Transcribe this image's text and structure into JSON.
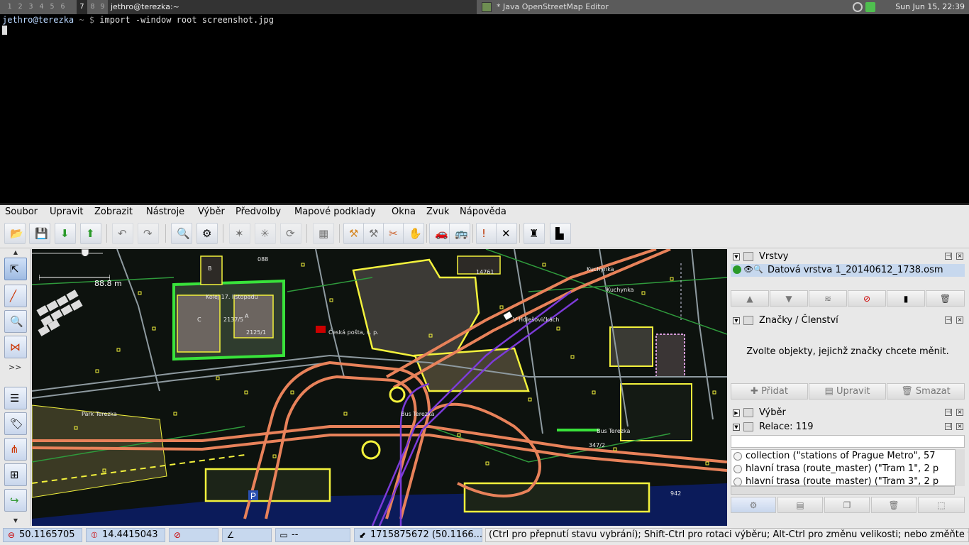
{
  "taskbar": {
    "workspaces": [
      "1",
      "2",
      "3",
      "4",
      "5",
      "6",
      "7",
      "8",
      "9"
    ],
    "terminal_title": "jethro@terezka:~",
    "josm_title": "* Java OpenStreetMap Editor",
    "clock": "Sun Jun 15, 22:39"
  },
  "terminal": {
    "prompt_user": "jethro@terezka",
    "prompt_rest": " ~ $",
    "command": " import -window root screenshot.jpg"
  },
  "menubar": {
    "items": [
      "Soubor",
      "Upravit",
      "Zobrazit",
      "Nástroje",
      "Výběr",
      "Předvolby",
      "Mapové podklady",
      "Okna",
      "Zvuk",
      "Nápověda"
    ]
  },
  "toolbar": {
    "icons": [
      "open-file-icon",
      "save-icon",
      "download-icon",
      "upload-icon",
      "undo-icon",
      "redo-icon",
      "preferences-icon",
      "search-tags-icon",
      "simplify-icon",
      "split-icon",
      "reload-icon",
      "grid-icon",
      "amenity-icon",
      "hiking-icon",
      "bicycle-icon",
      "hand-icon",
      "car-icon",
      "bus-icon",
      "warning-icon",
      "tools-icon",
      "castle-icon",
      "industry-icon"
    ]
  },
  "palette": {
    "icons": [
      "select-icon",
      "draw-icon",
      "zoom-icon",
      "improve-way-icon"
    ],
    "more": ">>",
    "panel_toggles": [
      "layers-toggle-icon",
      "tags-toggle-icon",
      "relations-toggle-icon",
      "selection-toggle-icon",
      "history-toggle-icon"
    ]
  },
  "map": {
    "scale": "88.8 m",
    "labels": [
      "Kolej 17. listopadu",
      "C",
      "2137/5",
      "A",
      "2125/1",
      "B",
      "088",
      "14761",
      "Kuchynka",
      "Kuchynka",
      "V Holešovičkách",
      "Česká pošta, s. p.",
      "Park Terezka",
      "Bus Terezka",
      "Bus Terezka",
      "347/2",
      "942"
    ],
    "colors": {
      "background": "#0d120e",
      "primary_road": "#e8825a",
      "highlight": "#39e23b",
      "building": "#3f3a34",
      "node": "#f3f23c",
      "tram": "#7c3bd8"
    }
  },
  "layers_panel": {
    "title": "Vrstvy",
    "layer_name": "Datová vrstva 1_20140612_1738.osm"
  },
  "tags_panel": {
    "title": "Značky / Členství",
    "message": "Zvolte objekty, jejichž značky chcete měnit.",
    "buttons": [
      "Přidat",
      "Upravit",
      "Smazat"
    ]
  },
  "selection_panel": {
    "title": "Výběr"
  },
  "relations_panel": {
    "title": "Relace: 119",
    "items": [
      "collection (\"stations of Prague Metro\", 57",
      "hlavní trasa (route_master) (\"Tram 1\", 2 p",
      "hlavní trasa (route_master) (\"Tram 3\", 2 p"
    ]
  },
  "statusbar": {
    "lat": "50.1165705",
    "lon": "14.4415043",
    "heading": "",
    "angle": "",
    "distance": "--",
    "node": "1715875672 (50.1166...",
    "help": "(Ctrl pro přepnutí stavu vybrání); Shift-Ctrl pro rotaci výběru; Alt-Ctrl pro změnu velikosti; nebo změňte výběr"
  }
}
